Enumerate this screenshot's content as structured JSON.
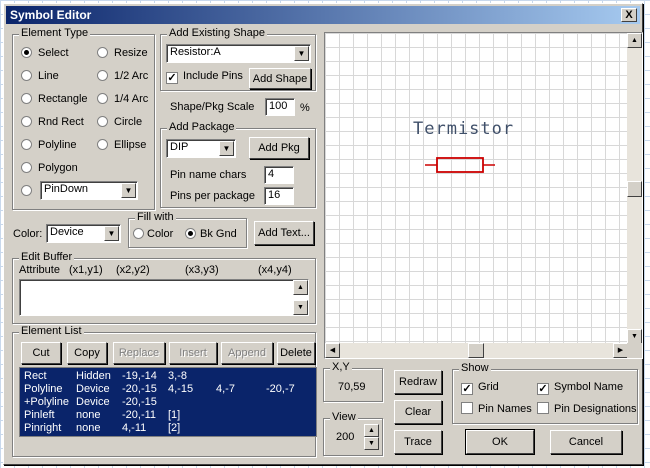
{
  "window": {
    "title": "Symbol Editor",
    "close_label": "X"
  },
  "element_type": {
    "legend": "Element Type",
    "options": [
      "Select",
      "Resize",
      "Line",
      "1/2 Arc",
      "Rectangle",
      "1/4 Arc",
      "Rnd Rect",
      "Circle",
      "Polyline",
      "Ellipse",
      "Polygon"
    ],
    "selected": "Select",
    "pin_select": "PinDown"
  },
  "add_existing": {
    "legend": "Add Existing Shape",
    "shape": "Resistor:A",
    "include_pins_label": "Include Pins",
    "include_pins_checked": true,
    "add_shape_label": "Add Shape"
  },
  "scale": {
    "label": "Shape/Pkg Scale",
    "value": "100",
    "unit": "%"
  },
  "add_package": {
    "legend": "Add Package",
    "package": "DIP",
    "add_pkg_label": "Add Pkg",
    "pin_name_chars_label": "Pin name chars",
    "pin_name_chars": "4",
    "pins_per_package_label": "Pins per package",
    "pins_per_package": "16"
  },
  "color": {
    "label": "Color:",
    "value": "Device"
  },
  "fill_with": {
    "legend": "Fill with",
    "color_label": "Color",
    "bkgnd_label": "Bk Gnd",
    "selected": "Bk Gnd"
  },
  "add_text_label": "Add Text...",
  "edit_buffer": {
    "legend": "Edit Buffer",
    "headers": [
      "Attribute",
      "(x1,y1)",
      "(x2,y2)",
      "(x3,y3)",
      "(x4,y4)"
    ]
  },
  "element_list": {
    "legend": "Element List",
    "buttons": [
      {
        "label": "Cut",
        "enabled": true
      },
      {
        "label": "Copy",
        "enabled": true
      },
      {
        "label": "Replace",
        "enabled": false
      },
      {
        "label": "Insert",
        "enabled": false
      },
      {
        "label": "Append",
        "enabled": false
      },
      {
        "label": "Delete",
        "enabled": true
      }
    ],
    "rows": [
      [
        "Rect",
        "Hidden",
        "-19,-14",
        "3,-8",
        "",
        ""
      ],
      [
        "Polyline",
        "Device",
        "-20,-15",
        "4,-15",
        "4,-7",
        "-20,-7"
      ],
      [
        "+Polyline",
        "Device",
        "-20,-15",
        "",
        "",
        ""
      ],
      [
        "Pinleft",
        "none",
        "-20,-11",
        "[1]",
        "",
        ""
      ],
      [
        "Pinright",
        "none",
        "4,-11",
        "[2]",
        "",
        ""
      ]
    ]
  },
  "canvas": {
    "symbol_name": "Termistor",
    "symbol_color": "#cc0000"
  },
  "xy": {
    "legend": "X,Y",
    "value": "70,59"
  },
  "view": {
    "legend": "View",
    "value": "200"
  },
  "actions": {
    "redraw": "Redraw",
    "clear": "Clear",
    "trace": "Trace",
    "ok": "OK",
    "cancel": "Cancel"
  },
  "show": {
    "legend": "Show",
    "grid_label": "Grid",
    "grid": true,
    "symbol_name_label": "Symbol Name",
    "symbol_name": true,
    "pin_names_label": "Pin Names",
    "pin_names": false,
    "pin_designations_label": "Pin Designations",
    "pin_designations": false
  }
}
